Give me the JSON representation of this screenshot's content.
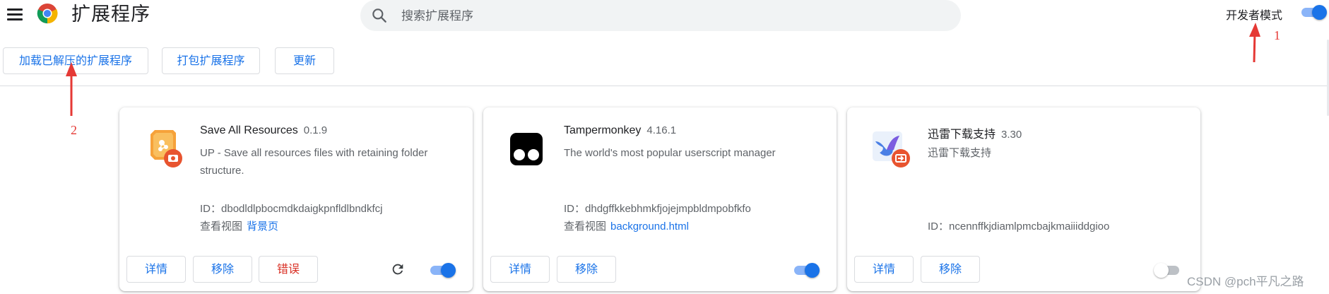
{
  "header": {
    "title": "扩展程序",
    "search_placeholder": "搜索扩展程序",
    "developer_mode_label": "开发者模式",
    "developer_mode_on": true
  },
  "toolbar": {
    "load_unpacked": "加载已解压的扩展程序",
    "pack": "打包扩展程序",
    "update": "更新"
  },
  "extensions": [
    {
      "name": "Save All Resources",
      "version": "0.1.9",
      "description": "UP - Save all resources files with retaining folder structure.",
      "id_label": "ID：",
      "id": "dbodldlpbocmdkdaigkpnfldlbndkfcj",
      "views_label": "查看视图",
      "view_link": "背景页",
      "details": "详情",
      "remove": "移除",
      "errors": "错误",
      "enabled": true
    },
    {
      "name": "Tampermonkey",
      "version": "4.16.1",
      "description": "The world's most popular userscript manager",
      "id_label": "ID：",
      "id": "dhdgffkkebhmkfjojejmpbldmpobfkfo",
      "views_label": "查看视图",
      "view_link": "background.html",
      "details": "详情",
      "remove": "移除",
      "enabled": true
    },
    {
      "name": "迅雷下载支持",
      "version": "3.30",
      "description": "迅雷下载支持",
      "id_label": "ID：",
      "id": "ncennffkjdiamlpmcbajkmaiiiddgioo",
      "details": "详情",
      "remove": "移除",
      "enabled": false
    }
  ],
  "annotations": {
    "one": "1",
    "two": "2",
    "color": "#e53935"
  },
  "watermark": "CSDN @pch平凡之路",
  "colors": {
    "accent": "#1a73e8",
    "error": "#d93025",
    "toggle_track_on": "#8ab4f8",
    "toggle_track_off": "#bdc1c6"
  }
}
